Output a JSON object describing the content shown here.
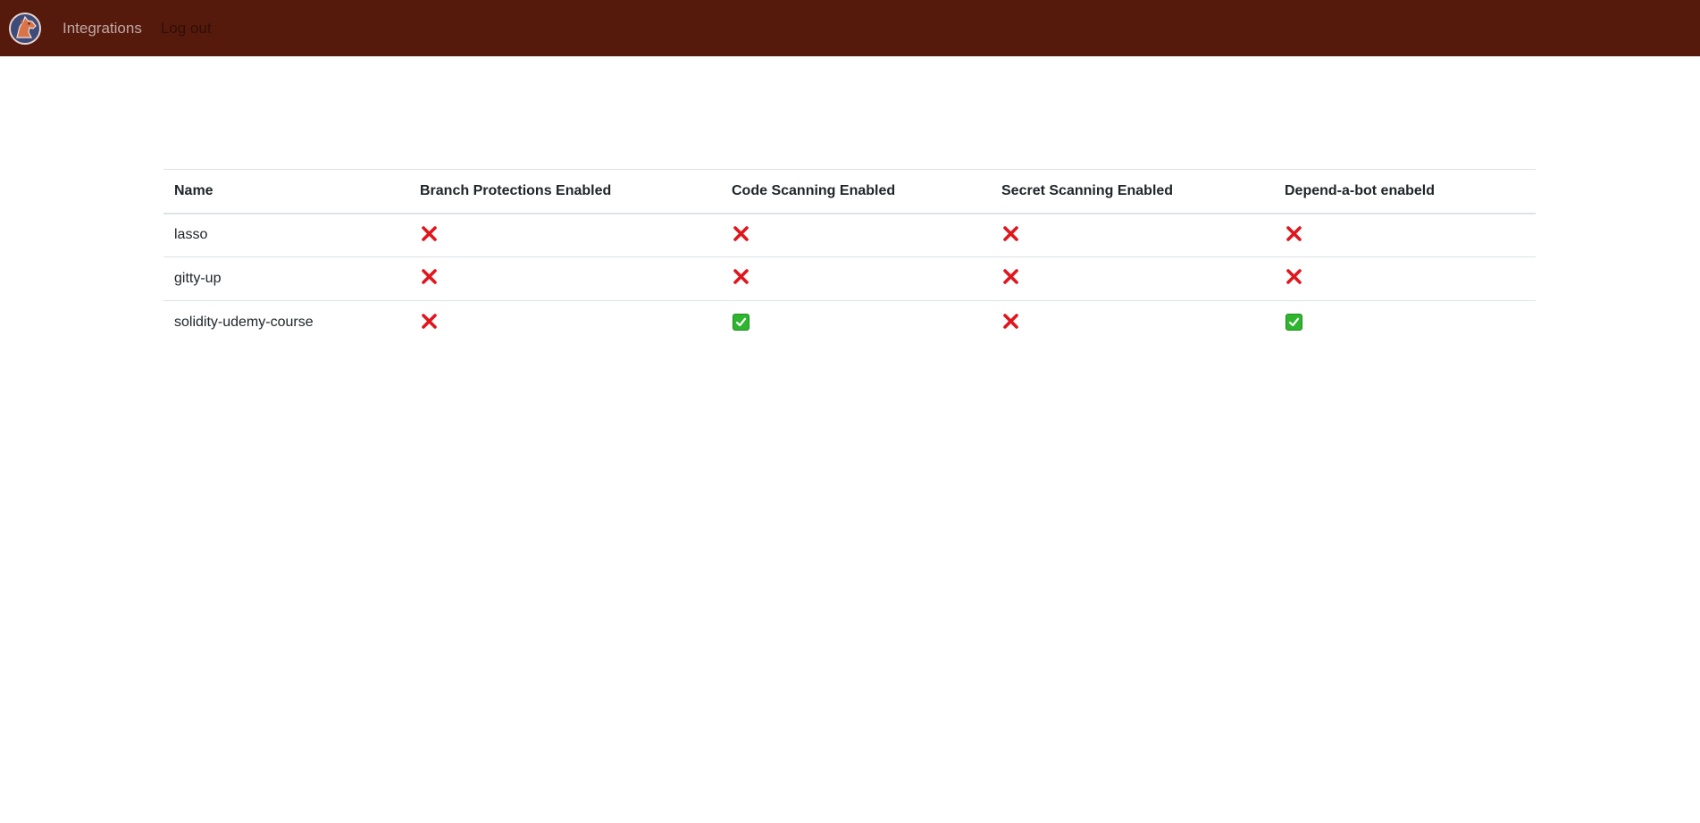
{
  "nav": {
    "logo_icon": "horse-head-icon",
    "links": [
      "Integrations",
      "Log out"
    ]
  },
  "table": {
    "headers": [
      "Name",
      "Branch Protections Enabled",
      "Code Scanning Enabled",
      "Secret Scanning Enabled",
      "Depend-a-bot enabeld"
    ],
    "rows": [
      {
        "name": "lasso",
        "branch_protections": false,
        "code_scanning": false,
        "secret_scanning": false,
        "dependabot": false
      },
      {
        "name": "gitty-up",
        "branch_protections": false,
        "code_scanning": false,
        "secret_scanning": false,
        "dependabot": false
      },
      {
        "name": "solidity-udemy-course",
        "branch_protections": false,
        "code_scanning": true,
        "secret_scanning": false,
        "dependabot": true
      }
    ]
  },
  "icons": {
    "enabled": "check-icon",
    "disabled": "cross-icon"
  },
  "colors": {
    "navbar": "#561a0d",
    "cross": "#e0161d",
    "check": "#2fb52f"
  }
}
